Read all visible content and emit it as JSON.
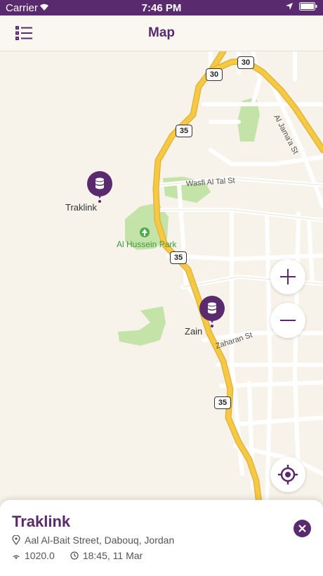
{
  "status": {
    "carrier": "Carrier",
    "time": "7:46 PM"
  },
  "navbar": {
    "title": "Map",
    "menu_icon": "list-icon"
  },
  "map": {
    "road_labels": [
      "Wasfi Al Tal St",
      "Al Jama'a St",
      "Zaharan St"
    ],
    "park_label": "Al Hussein Park",
    "shields": [
      "30",
      "30",
      "35",
      "35",
      "35",
      "35"
    ],
    "pins": [
      {
        "label": "Traklink",
        "icon": "database-icon"
      },
      {
        "label": "Zain",
        "icon": "database-icon"
      }
    ],
    "controls": {
      "zoom_in": "+",
      "zoom_out": "−",
      "locate_icon": "crosshair-icon"
    }
  },
  "sheet": {
    "name": "Traklink",
    "address": "Aal Al-Bait Street, Dabouq, Jordan",
    "value": "1020.0",
    "time": "18:45, 11 Mar"
  },
  "colors": {
    "accent": "#5a2a6e",
    "highway": "#f5c944",
    "park": "#c4e3a9"
  }
}
